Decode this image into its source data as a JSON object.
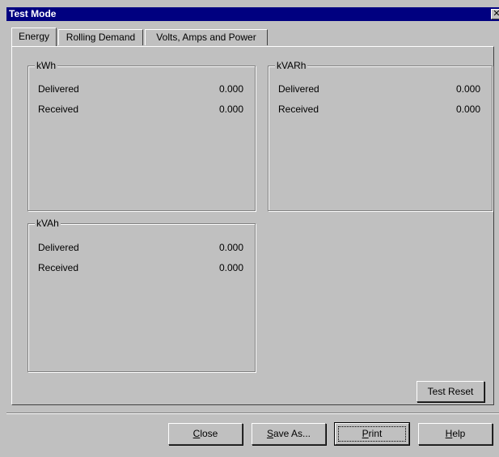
{
  "window": {
    "title": "Test Mode",
    "close_glyph": "✕"
  },
  "tabs": [
    {
      "label": "Energy",
      "active": true
    },
    {
      "label": "Rolling Demand",
      "active": false
    },
    {
      "label": "Volts, Amps and Power",
      "active": false
    }
  ],
  "groups": {
    "kwh": {
      "title": "kWh",
      "rows": [
        {
          "label": "Delivered",
          "value": "0.000"
        },
        {
          "label": "Received",
          "value": "0.000"
        }
      ]
    },
    "kvarh": {
      "title": "kVARh",
      "rows": [
        {
          "label": "Delivered",
          "value": "0.000"
        },
        {
          "label": "Received",
          "value": "0.000"
        }
      ]
    },
    "kvah": {
      "title": "kVAh",
      "rows": [
        {
          "label": "Delivered",
          "value": "0.000"
        },
        {
          "label": "Received",
          "value": "0.000"
        }
      ]
    }
  },
  "buttons": {
    "test_reset": "Test Reset",
    "close_accel": "C",
    "close_rest": "lose",
    "save_as_accel": "S",
    "save_as_rest": "ave As...",
    "print_accel": "P",
    "print_rest": "rint",
    "help_accel": "H",
    "help_rest": "elp"
  }
}
